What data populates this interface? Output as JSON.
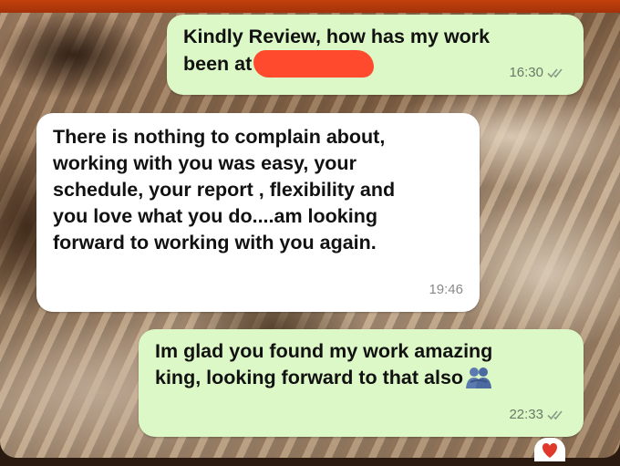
{
  "chat": {
    "messages": [
      {
        "direction": "outgoing",
        "text_before": "Kindly Review, how has my work\nbeen at",
        "time": "16:30",
        "read_ticks": "double-check-icon"
      },
      {
        "direction": "incoming",
        "text": "There is nothing to complain about,\nworking with you was easy, your\nschedule, your report , flexibility and\nyou love what you do....am looking\nforward to working with you again.",
        "time": "19:46"
      },
      {
        "direction": "outgoing",
        "text": "Im glad you found my work amazing\nking, looking forward to that also",
        "emoji": "people-hugging-icon",
        "time": "22:33",
        "read_ticks": "double-check-icon"
      }
    ]
  },
  "colors": {
    "outgoing_bubble": "#dcf8c6",
    "incoming_bubble": "#ffffff",
    "redaction": "#ff4a2e",
    "top_bar": "#c2410c"
  }
}
